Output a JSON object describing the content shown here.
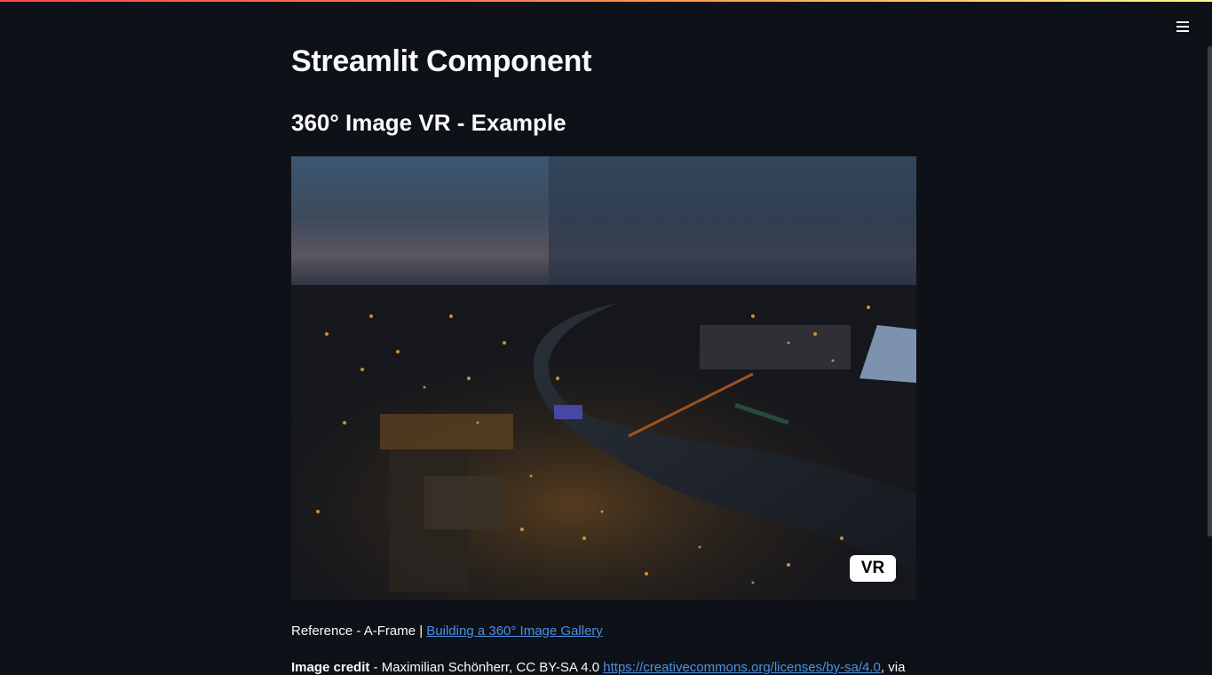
{
  "app": {
    "colors": {
      "background": "#0e1117",
      "text": "#fafafa",
      "link": "#4a90e2",
      "accent_gradient": [
        "#ff4b4b",
        "#fffd80"
      ]
    },
    "menu_icon": "hamburger-menu-icon"
  },
  "main": {
    "title": "Streamlit Component",
    "subtitle": "360° Image VR - Example",
    "viewer": {
      "vr_button_label": "VR"
    },
    "reference": {
      "prefix": "Reference - A-Frame |",
      "link_text": "Building a 360° Image Gallery"
    },
    "credit": {
      "label": "Image credit",
      "text": " - Maximilian Schönherr, CC BY-SA 4.0 ",
      "link_text": "https://creativecommons.org/licenses/by-sa/4.0",
      "suffix": ", via"
    }
  }
}
